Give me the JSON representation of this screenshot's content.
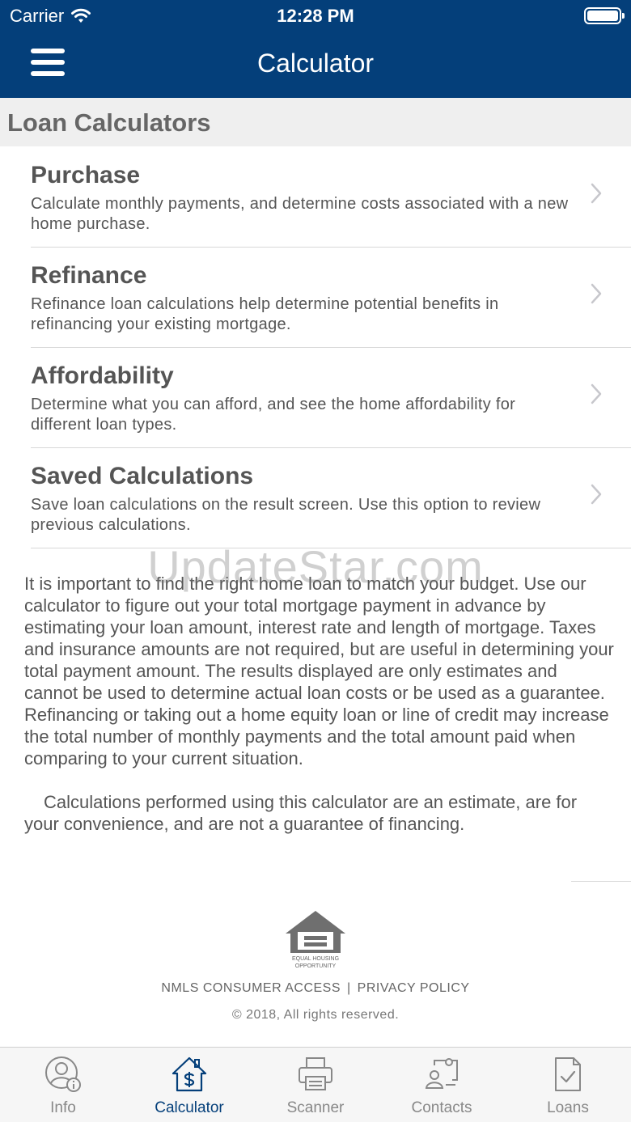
{
  "status_bar": {
    "carrier": "Carrier",
    "time": "12:28 PM"
  },
  "nav": {
    "title": "Calculator"
  },
  "section": {
    "header": "Loan Calculators"
  },
  "items": [
    {
      "title": "Purchase",
      "desc": "Calculate monthly payments, and determine costs associated with a new home purchase."
    },
    {
      "title": "Refinance",
      "desc": "Refinance loan calculations help determine potential benefits in refinancing your existing mortgage."
    },
    {
      "title": "Affordability",
      "desc": "Determine what you can afford, and see the home affordability for different loan types."
    },
    {
      "title": "Saved Calculations",
      "desc": "Save loan calculations on the result screen. Use this option to review previous calculations."
    }
  ],
  "watermark": "UpdateStar.com",
  "body": {
    "paragraph1": "It is important to find the right home loan to match your budget. Use our calculator to figure out your total mortgage payment in advance by estimating your loan amount, interest rate and length of mortgage. Taxes and insurance amounts are not required, but are useful in determining your total payment amount. The results displayed are only estimates and cannot be used to determine actual loan costs or be used as a guarantee. Refinancing or taking out a home equity loan or line of credit may increase the total number of monthly payments and the total amount paid when comparing to your current situation.",
    "paragraph2": "Calculations performed using this calculator are an estimate, are for your convenience, and are not a guarantee of financing."
  },
  "footer": {
    "eho_line1": "EQUAL HOUSING",
    "eho_line2": "OPPORTUNITY",
    "nmls_link": "NMLS CONSUMER ACCESS",
    "separator": "|",
    "privacy_link": "PRIVACY POLICY",
    "copyright": "© 2018, All rights reserved."
  },
  "tabs": [
    {
      "label": "Info",
      "icon": "info-user-icon",
      "active": false
    },
    {
      "label": "Calculator",
      "icon": "house-dollar-icon",
      "active": true
    },
    {
      "label": "Scanner",
      "icon": "printer-icon",
      "active": false
    },
    {
      "label": "Contacts",
      "icon": "contacts-icon",
      "active": false
    },
    {
      "label": "Loans",
      "icon": "document-check-icon",
      "active": false
    }
  ],
  "colors": {
    "brand": "#043f7a",
    "section_bg": "#efefef",
    "text": "#555555",
    "tab_inactive": "#888888"
  }
}
